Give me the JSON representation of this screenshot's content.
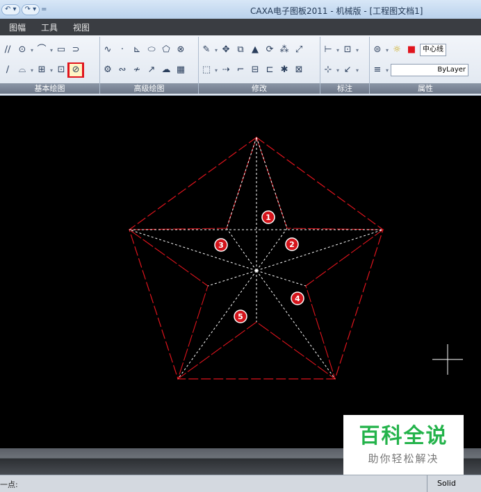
{
  "window": {
    "title": "CAXA电子图板2011 - 机械版 - [工程图文档1]"
  },
  "quick_access": {
    "undo": "↶ ▾",
    "redo": "↷ ▾",
    "more": "="
  },
  "menu": {
    "items": [
      "图幅",
      "工具",
      "视图"
    ]
  },
  "ribbon": {
    "groups": [
      {
        "label": "基本绘图"
      },
      {
        "label": "高级绘图"
      },
      {
        "label": "修改"
      },
      {
        "label": "标注"
      },
      {
        "label": "属性"
      }
    ],
    "properties": {
      "linetype_layer": "中心线",
      "linetype": "ByLayer"
    }
  },
  "drawing": {
    "markers": [
      "1",
      "2",
      "3",
      "4",
      "5"
    ],
    "colors": {
      "outline": "#e0141d",
      "guides": "#ffffff",
      "marker_fill": "#d4141b"
    }
  },
  "status": {
    "prompt": "一点:",
    "mode": "Solid"
  },
  "watermark": {
    "main": "百科全说",
    "sub": "助你轻松解决"
  }
}
